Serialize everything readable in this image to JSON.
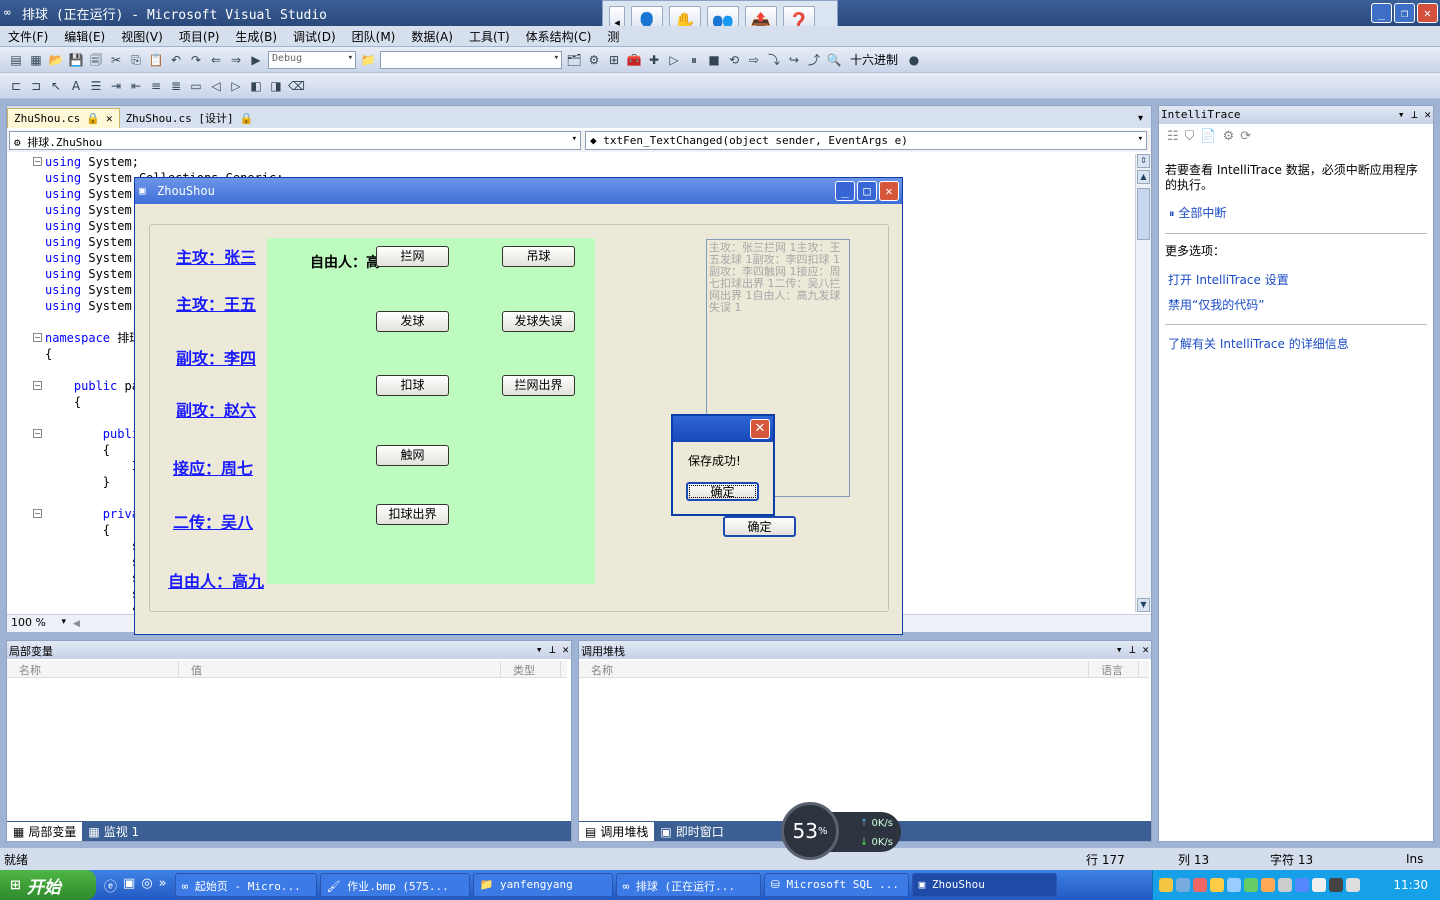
{
  "window": {
    "title": "排球 (正在运行) - Microsoft Visual Studio"
  },
  "menu": [
    "文件(F)",
    "编辑(E)",
    "视图(V)",
    "项目(P)",
    "生成(B)",
    "调试(D)",
    "团队(M)",
    "数据(A)",
    "工具(T)",
    "体系结构(C)",
    "测"
  ],
  "toolbar": {
    "config": "Debug",
    "hex_label": "十六进制"
  },
  "tabs": [
    "ZhuShou.cs",
    "ZhuShou.cs [设计]"
  ],
  "nav": {
    "class": "排球.ZhuShou",
    "member": "txtFen_TextChanged(object sender, EventArgs e)"
  },
  "code": [
    "using System;",
    "using System.Collections.Generic;",
    "using System.",
    "using System.",
    "using System.",
    "using System.",
    "using System.",
    "using System.",
    "using System.",
    "using System.",
    "",
    "namespace 排球",
    "{",
    "",
    "    public pa",
    "    {",
    "",
    "        publi",
    "        {",
    "            I",
    "        }",
    "",
    "        priva",
    "        {",
    "            s",
    "            s",
    "            s",
    "            s",
    "            s"
  ],
  "zoom": "100 %",
  "intellitrace": {
    "title": "IntelliTrace",
    "message": "若要查看 IntelliTrace 数据，必须中断应用程序的执行。",
    "break_all": "全部中断",
    "more_options": "更多选项：",
    "open_settings": "打开 IntelliTrace 设置",
    "disable_just_my_code": "禁用“仅我的代码”",
    "learn_more": "了解有关 IntelliTrace 的详细信息"
  },
  "locals": {
    "title": "局部变量",
    "cols": [
      "名称",
      "值",
      "类型"
    ],
    "tabs": [
      "局部变量",
      "监视 1"
    ]
  },
  "callstack": {
    "title": "调用堆栈",
    "cols": [
      "名称",
      "语言"
    ],
    "tabs": [
      "调用堆栈",
      "即时窗口"
    ]
  },
  "status": {
    "ready": "就绪",
    "row": "行 177",
    "col": "列 13",
    "char": "字符 13",
    "mode": "Ins"
  },
  "form": {
    "title": "ZhouShou",
    "players": [
      "主攻：张三",
      "主攻：王五",
      "副攻：李四",
      "副攻：赵六",
      "接应：周七",
      "二传：吴八",
      "自由人：高九"
    ],
    "ziyou_label": "自由人：高",
    "buttons": [
      "拦网",
      "吊球",
      "发球",
      "发球失误",
      "扣球",
      "拦网出界",
      "触网",
      "扣球出界"
    ],
    "log": "主攻：张三拦网 1主攻：王五发球 1副攻：李四扣球 1副攻：李四触网 1接应：周七扣球出界 1二传：吴八拦网出界 1自由人：高九发球失误 1",
    "confirm": "确定"
  },
  "msgbox": {
    "text": "保存成功!",
    "ok": "确定"
  },
  "gauge": {
    "percent": "53",
    "unit": "%",
    "up": "0K/s",
    "down": "0K/s"
  },
  "taskbar": {
    "start": "开始",
    "tasks": [
      "起始页 - Micro...",
      "作业.bmp (575...",
      "yanfengyang",
      "排球 (正在运行...",
      "Microsoft SQL ...",
      "ZhouShou"
    ],
    "clock": "11:30"
  }
}
